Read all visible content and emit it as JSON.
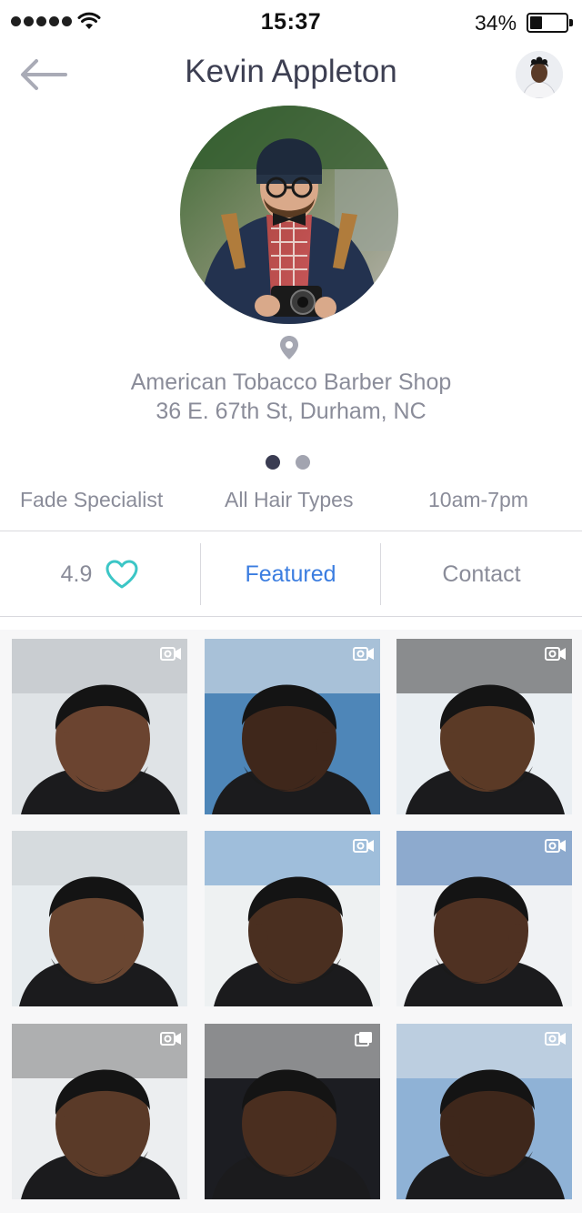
{
  "status_bar": {
    "time": "15:37",
    "battery_percent": "34%",
    "battery_level": 0.34,
    "signal_bars": 5
  },
  "header": {
    "title": "Kevin Appleton",
    "back_icon": "arrow-left-icon",
    "avatar_icon": "user-avatar"
  },
  "profile": {
    "shop_name": "American Tobacco Barber Shop",
    "address": "36 E. 67th St, Durham, NC",
    "pin_icon": "location-pin-icon",
    "pager": {
      "pages": 2,
      "current": 1
    }
  },
  "tags": [
    "Fade Specialist",
    "All Hair Types",
    "10am-7pm"
  ],
  "tabs": {
    "rating": "4.9",
    "rating_icon": "heart-outline-icon",
    "featured": "Featured",
    "contact": "Contact"
  },
  "colors": {
    "accent_blue": "#3b7de0",
    "heart_teal": "#3cc6c6",
    "title_dark": "#3d3f52",
    "muted_gray": "#8a8c99"
  },
  "gallery": {
    "items": [
      {
        "label": "haircut-photo-1",
        "overlay_icon": "video-camera-icon"
      },
      {
        "label": "haircut-photo-2",
        "overlay_icon": "video-camera-icon"
      },
      {
        "label": "haircut-photo-3",
        "overlay_icon": "video-camera-icon"
      },
      {
        "label": "haircut-photo-4",
        "overlay_icon": ""
      },
      {
        "label": "haircut-photo-5",
        "overlay_icon": "video-camera-icon"
      },
      {
        "label": "haircut-photo-6",
        "overlay_icon": "video-camera-icon"
      },
      {
        "label": "haircut-photo-7",
        "overlay_icon": "video-camera-icon"
      },
      {
        "label": "haircut-photo-8",
        "overlay_icon": "photo-gallery-icon"
      },
      {
        "label": "haircut-photo-9",
        "overlay_icon": "video-camera-icon"
      }
    ]
  }
}
